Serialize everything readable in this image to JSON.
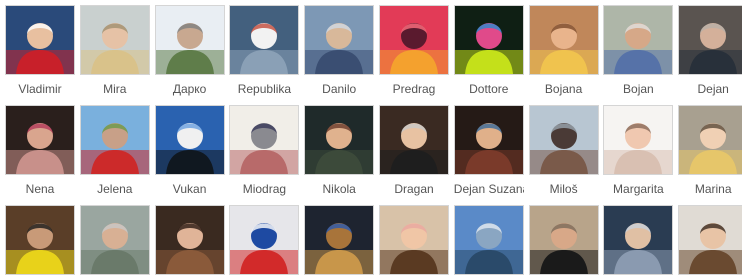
{
  "friends_grid": {
    "people": [
      {
        "name": "Vladimir",
        "photo": {
          "bg": "#2a4a7a",
          "mid": "#c8202a",
          "skin": "#e8c0a0",
          "accent": "#ffffff"
        }
      },
      {
        "name": "Mira",
        "photo": {
          "bg": "#c9d0cf",
          "mid": "#d9c28a",
          "skin": "#e6c2a6",
          "accent": "#a09070"
        }
      },
      {
        "name": "Дарко",
        "photo": {
          "bg": "#e9eef3",
          "mid": "#5f7d4a",
          "skin": "#c8a890",
          "accent": "#808080"
        }
      },
      {
        "name": "Republika",
        "photo": {
          "bg": "#43607e",
          "mid": "#8aa0b6",
          "skin": "#f2f2f2",
          "accent": "#c24a3a"
        }
      },
      {
        "name": "Danilo",
        "photo": {
          "bg": "#7d98b5",
          "mid": "#3a4e72",
          "skin": "#d8b89a",
          "accent": "#cfd8e4"
        }
      },
      {
        "name": "Predrag",
        "photo": {
          "bg": "#e23b57",
          "mid": "#f4a12e",
          "skin": "#5a1a2e",
          "accent": "#ff6f7f"
        }
      },
      {
        "name": "Dottore",
        "photo": {
          "bg": "#0f1f14",
          "mid": "#c4e01a",
          "skin": "#e04a8a",
          "accent": "#2a8ad0"
        }
      },
      {
        "name": "Bojana",
        "photo": {
          "bg": "#c0875a",
          "mid": "#f0c34e",
          "skin": "#e9b48c",
          "accent": "#7a4a2a"
        }
      },
      {
        "name": "Bojan",
        "photo": {
          "bg": "#aeb6a8",
          "mid": "#5672a8",
          "skin": "#d6a888",
          "accent": "#e0e0e0"
        }
      },
      {
        "name": "Dejan",
        "photo": {
          "bg": "#5a5450",
          "mid": "#28303a",
          "skin": "#d4b09a",
          "accent": "#b8b0a8"
        }
      },
      {
        "name": "Nena",
        "photo": {
          "bg": "#2a1f1c",
          "mid": "#c8908a",
          "skin": "#d9a58e",
          "accent": "#b23a5a"
        }
      },
      {
        "name": "Jelena",
        "photo": {
          "bg": "#7ab0dd",
          "mid": "#cc2a2a",
          "skin": "#c8a088",
          "accent": "#6a9a4a"
        }
      },
      {
        "name": "Vukan",
        "photo": {
          "bg": "#2a62b0",
          "mid": "#101820",
          "skin": "#f0f0f0",
          "accent": "#6aa0e0"
        }
      },
      {
        "name": "Miodrag",
        "photo": {
          "bg": "#f1eee8",
          "mid": "#b86a6a",
          "skin": "#8a8a90",
          "accent": "#3a3a5a"
        }
      },
      {
        "name": "Nikola",
        "photo": {
          "bg": "#1f2a2a",
          "mid": "#3c4a3a",
          "skin": "#e0b28e",
          "accent": "#6a3a2a"
        }
      },
      {
        "name": "Dragan",
        "photo": {
          "bg": "#3a2a22",
          "mid": "#1e1e1e",
          "skin": "#e8c2a2",
          "accent": "#c8c8c8"
        }
      },
      {
        "name": "Dejan Suzana",
        "photo": {
          "bg": "#251a16",
          "mid": "#7a3a2a",
          "skin": "#e0b08a",
          "accent": "#3a6a9a"
        }
      },
      {
        "name": "Miloš",
        "photo": {
          "bg": "#b8c6d2",
          "mid": "#7a5a4a",
          "skin": "#4a3a36",
          "accent": "#9aa6b0"
        }
      },
      {
        "name": "Margarita",
        "photo": {
          "bg": "#f6f4f2",
          "mid": "#d9c0b2",
          "skin": "#f0c8b0",
          "accent": "#8a6a5a"
        }
      },
      {
        "name": "Marina",
        "photo": {
          "bg": "#a8a090",
          "mid": "#e6c66a",
          "skin": "#f0d0b4",
          "accent": "#5a4a3a"
        }
      },
      {
        "name": "",
        "photo": {
          "bg": "#5a3e28",
          "mid": "#e8d21a",
          "skin": "#c89a78",
          "accent": "#1a1a1a"
        }
      },
      {
        "name": "",
        "photo": {
          "bg": "#9aa6a0",
          "mid": "#6a7a6a",
          "skin": "#d8b094",
          "accent": "#c8c8c8"
        }
      },
      {
        "name": "",
        "photo": {
          "bg": "#3a2a20",
          "mid": "#8a5a3a",
          "skin": "#e0b498",
          "accent": "#2a1a14"
        }
      },
      {
        "name": "",
        "photo": {
          "bg": "#e6e6ea",
          "mid": "#d22a2a",
          "skin": "#1e4aa2",
          "accent": "#ffffff"
        }
      },
      {
        "name": "",
        "photo": {
          "bg": "#1e2430",
          "mid": "#c8964a",
          "skin": "#a8743a",
          "accent": "#2a5ab0"
        }
      },
      {
        "name": "",
        "photo": {
          "bg": "#d8c2a8",
          "mid": "#5a3a22",
          "skin": "#f0c6a6",
          "accent": "#e8a6a0"
        }
      },
      {
        "name": "",
        "photo": {
          "bg": "#5a8ac8",
          "mid": "#2a4a6a",
          "skin": "#8aa6c2",
          "accent": "#e0e8f2"
        }
      },
      {
        "name": "",
        "photo": {
          "bg": "#b8a48a",
          "mid": "#1a1a1a",
          "skin": "#d8a888",
          "accent": "#7a6a5a"
        }
      },
      {
        "name": "",
        "photo": {
          "bg": "#2a3c52",
          "mid": "#8a9ab0",
          "skin": "#e0c0a4",
          "accent": "#c8d0da"
        }
      },
      {
        "name": "",
        "photo": {
          "bg": "#e0dbd4",
          "mid": "#6a4a30",
          "skin": "#e8c4a6",
          "accent": "#3a2a20"
        }
      }
    ]
  }
}
